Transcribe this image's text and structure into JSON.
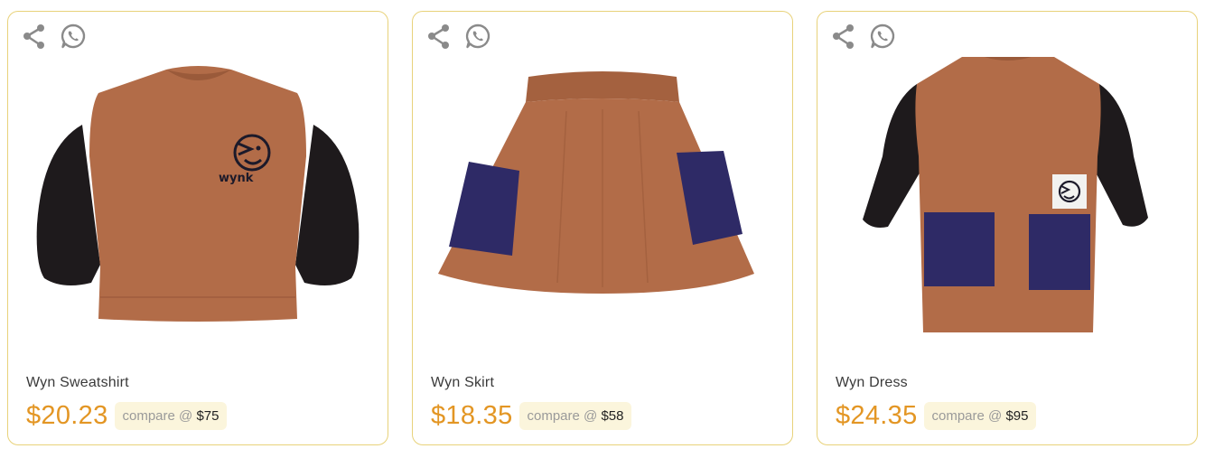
{
  "products": [
    {
      "name": "Wyn Sweatshirt",
      "price": "$20.23",
      "compare_label": "compare @",
      "compare_price": "$75"
    },
    {
      "name": "Wyn Skirt",
      "price": "$18.35",
      "compare_label": "compare @",
      "compare_price": "$58"
    },
    {
      "name": "Wyn Dress",
      "price": "$24.35",
      "compare_label": "compare @",
      "compare_price": "$95"
    }
  ],
  "garment_text": {
    "brand_logo": "wynk"
  },
  "icons": {
    "share": "share-icon",
    "whatsapp": "whatsapp-icon"
  },
  "colors": {
    "price": "#e39624",
    "card_border": "#e8d27a",
    "compare_bg": "#fbf5dc",
    "fabric_brown": "#b26c48",
    "sleeve_black": "#1e1a1c",
    "pocket_navy": "#2e2a66"
  }
}
